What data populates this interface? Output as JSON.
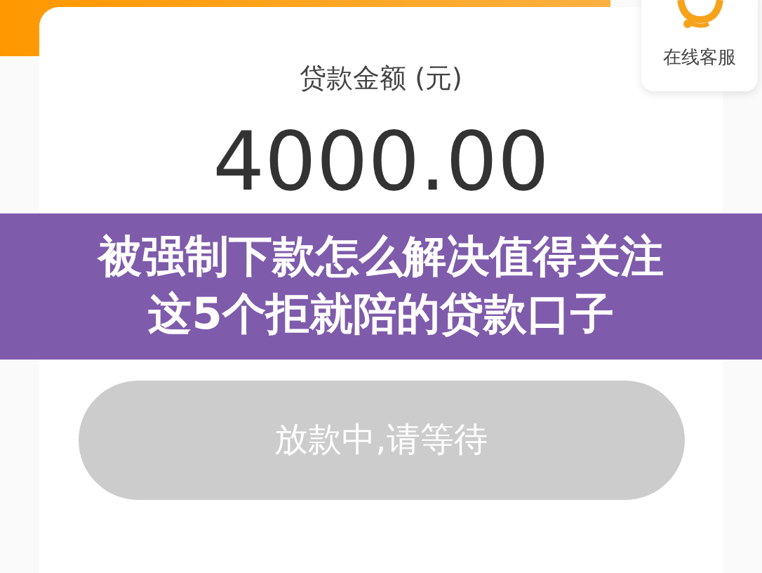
{
  "service_widget": {
    "label": "在线客服"
  },
  "loan_card": {
    "amount_label": "贷款金额 (元)",
    "amount": "4000.00"
  },
  "banner": {
    "lines": [
      "被强制下款怎么解决值得关注",
      "这5个拒就陪的贷款口子"
    ]
  },
  "status_button": {
    "label": "放款中,请等待",
    "disabled": true
  }
}
